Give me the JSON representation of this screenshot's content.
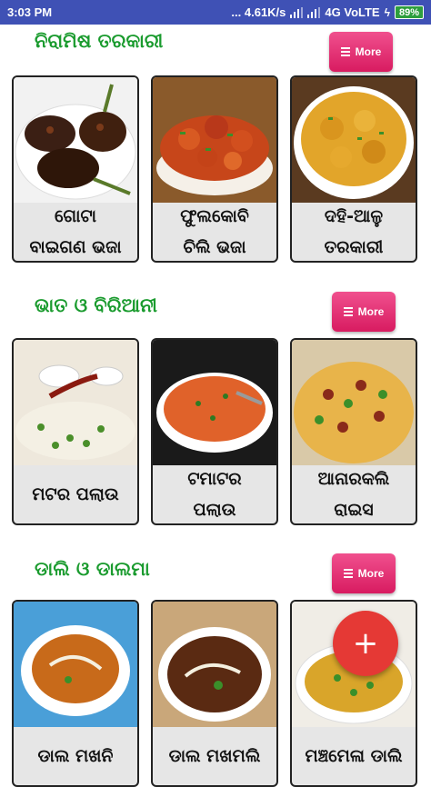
{
  "status_bar": {
    "time": "3:03 PM",
    "speed": "... 4.61K/s",
    "network": "4G VoLTE",
    "battery": "89%"
  },
  "sections": [
    {
      "title": "ନିରାମିଷ ତରକାରୀ",
      "more_label": "More",
      "items": [
        {
          "label": "ଗୋଟା\nବାଇଗଣ ଭଜା",
          "image": "stuffed-brinjal-fry"
        },
        {
          "label": "ଫୁଲକୋବି\nଚିଲି ଭଜା",
          "image": "chilli-cauliflower"
        },
        {
          "label": "ଦହି-ଆଳୁ\nତରକାରୀ",
          "image": "dahi-aloo-curry"
        }
      ]
    },
    {
      "title": "ଭାତ ଓ ବିରିଆନୀ",
      "more_label": "More",
      "items": [
        {
          "label": "ମଟର ପଲାଉ",
          "image": "matar-pulao"
        },
        {
          "label": "ଟମାଟର\nପଲାଉ",
          "image": "tomato-pulao"
        },
        {
          "label": "ଆନାରକଲି\nରାଇସ",
          "image": "anarkali-rice"
        }
      ]
    },
    {
      "title": "ଡାଲି ଓ ଡାଲମା",
      "more_label": "More",
      "items": [
        {
          "label": "ଡାଲ ମଖନି",
          "image": "dal-makhani"
        },
        {
          "label": "ଡାଲ ମଖମଲି",
          "image": "dal-makhmali"
        },
        {
          "label": "ମଞ୍ଚମେଳା ଡାଲି",
          "image": "dal-soup"
        }
      ]
    }
  ],
  "fab": {
    "label": "+"
  },
  "colors": {
    "status_bar": "#3f51b5",
    "section_title": "#1a9b2e",
    "more_button": "#d81b60",
    "fab": "#e53935"
  }
}
